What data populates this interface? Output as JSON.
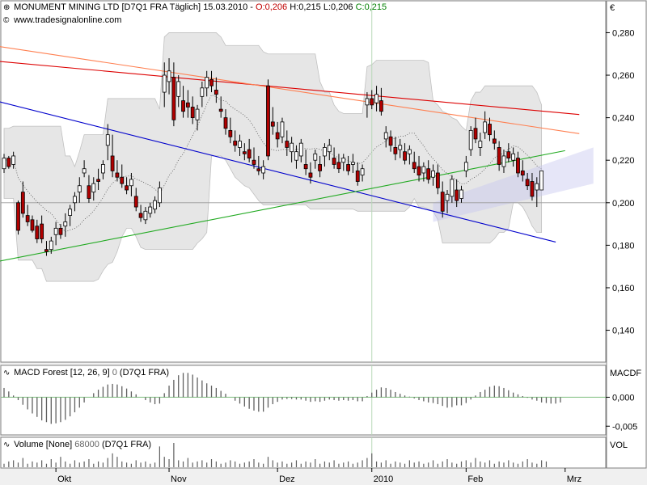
{
  "header": {
    "symbol": "MONUMENT MINING LTD [D7Q1 FRA",
    "interval": "Täglich]",
    "date": "15.03.2010",
    "open": "O:0,206",
    "high": "H:0,215",
    "low": "L:0,206",
    "close": "C:0,215",
    "source": "www.tradesignalonline.com",
    "currency": "€"
  },
  "macd": {
    "title": "MACD Forest [12, 26, 9]",
    "zero_flag": "0",
    "symbol": "(D7Q1 FRA)",
    "right_label": "MACDF"
  },
  "volume": {
    "title": "Volume [None]",
    "value": "68000",
    "symbol": "(D7Q1 FRA)",
    "right_label": "VOL"
  },
  "colors": {
    "up": "#ffffff",
    "down": "#b00000",
    "blue_line": "#0000cc",
    "red_line": "#dd0000",
    "orange_line": "#ff7f50",
    "green_line": "#22aa22",
    "band": "#d8d8d8"
  },
  "chart_data": {
    "type": "candlestick",
    "price_axis": {
      "ylim": [
        0.125,
        0.295
      ],
      "ticks": [
        "0,140",
        "0,160",
        "0,180",
        "0,200",
        "0,220",
        "0,240",
        "0,260",
        "0,280"
      ]
    },
    "macd_axis": {
      "ylim": [
        -0.0065,
        0.0055
      ],
      "ticks": [
        "0,000",
        "-0,005"
      ]
    },
    "x_labels": [
      "Okt",
      "Nov",
      "Dez",
      "2010",
      "Feb",
      "Mrz"
    ],
    "x_label_index": [
      11,
      35,
      58,
      78,
      98,
      119
    ],
    "candles": [
      [
        0.216,
        0.223,
        0.214,
        0.221
      ],
      [
        0.221,
        0.222,
        0.216,
        0.217
      ],
      [
        0.218,
        0.224,
        0.216,
        0.222
      ],
      [
        0.2,
        0.201,
        0.185,
        0.187
      ],
      [
        0.205,
        0.21,
        0.193,
        0.195
      ],
      [
        0.194,
        0.199,
        0.189,
        0.191
      ],
      [
        0.192,
        0.194,
        0.186,
        0.187
      ],
      [
        0.189,
        0.192,
        0.181,
        0.183
      ],
      [
        0.19,
        0.194,
        0.181,
        0.183
      ],
      [
        0.178,
        0.182,
        0.175,
        0.177
      ],
      [
        0.178,
        0.184,
        0.176,
        0.182
      ],
      [
        0.185,
        0.191,
        0.18,
        0.188
      ],
      [
        0.188,
        0.19,
        0.183,
        0.185
      ],
      [
        0.189,
        0.195,
        0.184,
        0.191
      ],
      [
        0.194,
        0.199,
        0.189,
        0.197
      ],
      [
        0.2,
        0.205,
        0.196,
        0.203
      ],
      [
        0.205,
        0.212,
        0.2,
        0.208
      ],
      [
        0.214,
        0.22,
        0.212,
        0.216
      ],
      [
        0.208,
        0.213,
        0.2,
        0.202
      ],
      [
        0.205,
        0.212,
        0.201,
        0.209
      ],
      [
        0.211,
        0.216,
        0.206,
        0.21
      ],
      [
        0.214,
        0.22,
        0.211,
        0.218
      ],
      [
        0.227,
        0.237,
        0.22,
        0.232
      ],
      [
        0.222,
        0.232,
        0.212,
        0.215
      ],
      [
        0.214,
        0.22,
        0.21,
        0.212
      ],
      [
        0.212,
        0.218,
        0.207,
        0.209
      ],
      [
        0.208,
        0.212,
        0.204,
        0.206
      ],
      [
        0.208,
        0.214,
        0.203,
        0.211
      ],
      [
        0.203,
        0.207,
        0.196,
        0.198
      ],
      [
        0.195,
        0.199,
        0.191,
        0.193
      ],
      [
        0.192,
        0.198,
        0.19,
        0.196
      ],
      [
        0.195,
        0.2,
        0.193,
        0.198
      ],
      [
        0.197,
        0.203,
        0.195,
        0.201
      ],
      [
        0.2,
        0.21,
        0.198,
        0.207
      ],
      [
        0.252,
        0.266,
        0.245,
        0.26
      ],
      [
        0.257,
        0.268,
        0.251,
        0.262
      ],
      [
        0.259,
        0.266,
        0.236,
        0.239
      ],
      [
        0.25,
        0.26,
        0.245,
        0.257
      ],
      [
        0.248,
        0.255,
        0.24,
        0.243
      ],
      [
        0.247,
        0.253,
        0.24,
        0.245
      ],
      [
        0.245,
        0.25,
        0.237,
        0.24
      ],
      [
        0.239,
        0.246,
        0.234,
        0.244
      ],
      [
        0.25,
        0.257,
        0.245,
        0.254
      ],
      [
        0.254,
        0.262,
        0.25,
        0.259
      ],
      [
        0.258,
        0.262,
        0.252,
        0.255
      ],
      [
        0.253,
        0.259,
        0.247,
        0.251
      ],
      [
        0.244,
        0.25,
        0.24,
        0.243
      ],
      [
        0.24,
        0.244,
        0.232,
        0.235
      ],
      [
        0.234,
        0.24,
        0.228,
        0.231
      ],
      [
        0.229,
        0.234,
        0.224,
        0.227
      ],
      [
        0.226,
        0.232,
        0.222,
        0.229
      ],
      [
        0.224,
        0.228,
        0.22,
        0.223
      ],
      [
        0.225,
        0.23,
        0.219,
        0.221
      ],
      [
        0.22,
        0.226,
        0.216,
        0.218
      ],
      [
        0.216,
        0.222,
        0.213,
        0.215
      ],
      [
        0.214,
        0.22,
        0.211,
        0.217
      ],
      [
        0.255,
        0.258,
        0.22,
        0.222
      ],
      [
        0.238,
        0.245,
        0.232,
        0.236
      ],
      [
        0.233,
        0.238,
        0.226,
        0.23
      ],
      [
        0.231,
        0.24,
        0.228,
        0.238
      ],
      [
        0.229,
        0.234,
        0.222,
        0.226
      ],
      [
        0.224,
        0.231,
        0.219,
        0.228
      ],
      [
        0.22,
        0.227,
        0.216,
        0.224
      ],
      [
        0.222,
        0.23,
        0.219,
        0.228
      ],
      [
        0.218,
        0.225,
        0.213,
        0.216
      ],
      [
        0.214,
        0.219,
        0.209,
        0.212
      ],
      [
        0.22,
        0.225,
        0.216,
        0.223
      ],
      [
        0.218,
        0.222,
        0.212,
        0.215
      ],
      [
        0.222,
        0.228,
        0.217,
        0.226
      ],
      [
        0.224,
        0.23,
        0.22,
        0.227
      ],
      [
        0.221,
        0.226,
        0.216,
        0.218
      ],
      [
        0.219,
        0.223,
        0.214,
        0.216
      ],
      [
        0.219,
        0.223,
        0.215,
        0.221
      ],
      [
        0.218,
        0.222,
        0.213,
        0.215
      ],
      [
        0.218,
        0.223,
        0.214,
        0.219
      ],
      [
        0.215,
        0.219,
        0.208,
        0.21
      ],
      [
        0.213,
        0.218,
        0.21,
        0.216
      ],
      [
        0.246,
        0.252,
        0.24,
        0.249
      ],
      [
        0.249,
        0.253,
        0.244,
        0.246
      ],
      [
        0.247,
        0.255,
        0.243,
        0.251
      ],
      [
        0.248,
        0.254,
        0.241,
        0.243
      ],
      [
        0.23,
        0.236,
        0.226,
        0.233
      ],
      [
        0.231,
        0.234,
        0.224,
        0.227
      ],
      [
        0.226,
        0.231,
        0.22,
        0.223
      ],
      [
        0.225,
        0.23,
        0.221,
        0.227
      ],
      [
        0.224,
        0.228,
        0.218,
        0.22
      ],
      [
        0.223,
        0.227,
        0.218,
        0.225
      ],
      [
        0.219,
        0.224,
        0.214,
        0.216
      ],
      [
        0.217,
        0.222,
        0.21,
        0.213
      ],
      [
        0.214,
        0.219,
        0.21,
        0.217
      ],
      [
        0.216,
        0.22,
        0.209,
        0.211
      ],
      [
        0.212,
        0.218,
        0.208,
        0.215
      ],
      [
        0.214,
        0.218,
        0.204,
        0.207
      ],
      [
        0.205,
        0.21,
        0.193,
        0.196
      ],
      [
        0.201,
        0.206,
        0.195,
        0.204
      ],
      [
        0.203,
        0.213,
        0.2,
        0.211
      ],
      [
        0.206,
        0.211,
        0.198,
        0.201
      ],
      [
        0.202,
        0.208,
        0.2,
        0.206
      ],
      [
        0.215,
        0.222,
        0.212,
        0.219
      ],
      [
        0.225,
        0.236,
        0.222,
        0.234
      ],
      [
        0.235,
        0.24,
        0.228,
        0.23
      ],
      [
        0.226,
        0.233,
        0.222,
        0.229
      ],
      [
        0.233,
        0.243,
        0.23,
        0.238
      ],
      [
        0.237,
        0.24,
        0.229,
        0.232
      ],
      [
        0.23,
        0.234,
        0.225,
        0.228
      ],
      [
        0.226,
        0.229,
        0.215,
        0.218
      ],
      [
        0.217,
        0.225,
        0.214,
        0.222
      ],
      [
        0.224,
        0.228,
        0.219,
        0.221
      ],
      [
        0.22,
        0.226,
        0.217,
        0.223
      ],
      [
        0.221,
        0.224,
        0.212,
        0.214
      ],
      [
        0.215,
        0.22,
        0.21,
        0.213
      ],
      [
        0.211,
        0.214,
        0.206,
        0.208
      ],
      [
        0.21,
        0.214,
        0.201,
        0.203
      ],
      [
        0.206,
        0.212,
        0.198,
        0.209
      ],
      [
        0.206,
        0.215,
        0.206,
        0.215
      ]
    ],
    "macd": [
      1.6,
      1.0,
      0.3,
      -0.5,
      -1.3,
      -2.1,
      -2.8,
      -3.4,
      -4.0,
      -4.3,
      -4.6,
      -4.5,
      -4.3,
      -3.9,
      -3.3,
      -2.6,
      -1.8,
      -0.9,
      0.0,
      0.7,
      1.3,
      1.8,
      2.2,
      2.3,
      2.2,
      1.9,
      1.5,
      1.0,
      0.5,
      0.0,
      -0.5,
      -0.9,
      -1.2,
      -1.1,
      0.7,
      2.0,
      3.0,
      3.8,
      4.2,
      4.2,
      3.9,
      3.4,
      2.9,
      2.4,
      2.0,
      1.6,
      1.1,
      0.6,
      0.0,
      -0.6,
      -1.1,
      -1.6,
      -2.0,
      -2.3,
      -2.5,
      -2.5,
      -1.8,
      -1.2,
      -0.8,
      -0.4,
      -0.3,
      -0.3,
      -0.4,
      -0.4,
      -0.6,
      -0.8,
      -0.7,
      -0.8,
      -0.6,
      -0.4,
      -0.5,
      -0.6,
      -0.5,
      -0.6,
      -0.5,
      -0.7,
      -0.7,
      0.2,
      0.8,
      1.3,
      1.7,
      1.6,
      1.3,
      0.9,
      0.6,
      0.3,
      0.1,
      -0.2,
      -0.5,
      -0.7,
      -0.9,
      -1.0,
      -1.2,
      -1.5,
      -1.8,
      -1.7,
      -1.4,
      -1.4,
      -1.0,
      -0.4,
      0.3,
      0.9,
      1.3,
      1.8,
      2.0,
      1.9,
      1.6,
      1.2,
      0.8,
      0.5,
      0.2,
      -0.1,
      -0.4,
      -0.6,
      -0.9,
      -1.0,
      -1.1,
      -1.1,
      -0.9
    ],
    "volume": [
      3,
      5,
      6,
      4,
      8,
      3,
      5,
      4,
      6,
      3,
      7,
      4,
      9,
      5,
      3,
      6,
      4,
      5,
      7,
      3,
      5,
      4,
      8,
      12,
      9,
      5,
      4,
      3,
      6,
      4,
      5,
      3,
      4,
      18,
      9,
      7,
      21,
      6,
      5,
      8,
      4,
      5,
      6,
      4,
      7,
      5,
      3,
      4,
      6,
      5,
      3,
      4,
      5,
      7,
      4,
      3,
      9,
      6,
      4,
      5,
      3,
      4,
      6,
      3,
      5,
      4,
      7,
      3,
      5,
      4,
      6,
      3,
      4,
      5,
      3,
      4,
      6,
      8,
      12,
      5,
      4,
      6,
      3,
      5,
      4,
      3,
      6,
      4,
      5,
      3,
      4,
      6,
      3,
      5,
      7,
      4,
      3,
      5,
      6,
      4,
      8,
      5,
      4,
      6,
      3,
      5,
      4,
      6,
      4,
      3,
      5,
      7,
      4,
      3,
      6,
      5
    ],
    "trendlines": [
      {
        "name": "blue",
        "from": [
          -1,
          0.2475
        ],
        "to": [
          117,
          0.1815
        ]
      },
      {
        "name": "red",
        "from": [
          -1,
          0.2665
        ],
        "to": [
          122,
          0.2415
        ]
      },
      {
        "name": "orange",
        "from": [
          -1,
          0.2735
        ],
        "to": [
          122,
          0.2325
        ]
      },
      {
        "name": "green",
        "from": [
          -1,
          0.1725
        ],
        "to": [
          119,
          0.2245
        ]
      }
    ]
  }
}
